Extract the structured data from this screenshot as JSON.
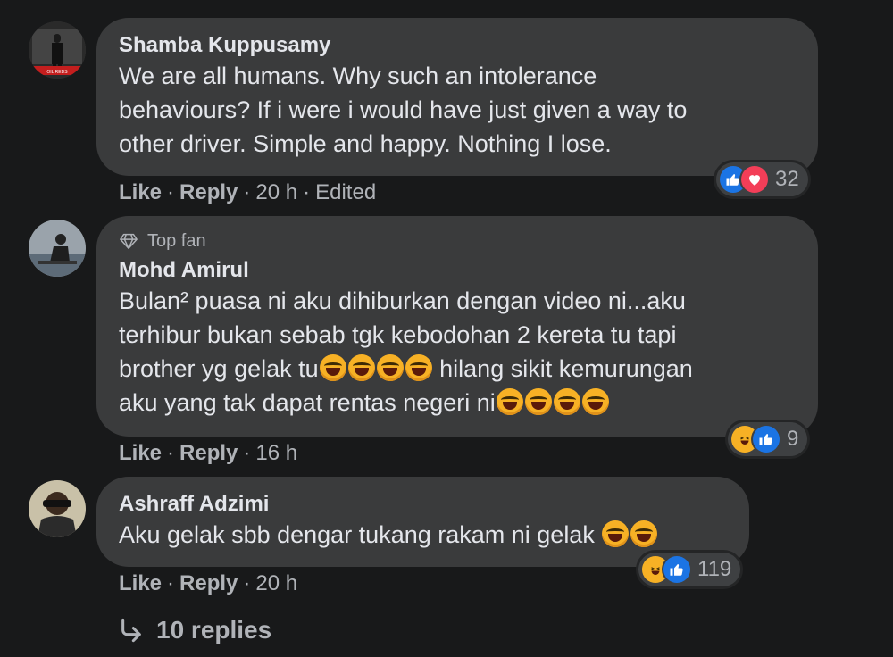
{
  "comments": [
    {
      "author": "Shamba Kuppusamy",
      "lines": [
        "We are all humans. Why such an intolerance",
        "behaviours? If i were i would have just given a way to",
        "other driver. Simple and happy. Nothing I lose."
      ],
      "like_label": "Like",
      "reply_label": "Reply",
      "time": "20 h",
      "edited": "Edited",
      "reaction_count": "32",
      "reaction_icons": [
        "like-icon",
        "love-icon"
      ],
      "avatar_caption": "OIL REDS"
    },
    {
      "badge": "Top fan",
      "author": "Mohd Amirul",
      "lines": [
        "Bulan² puasa ni aku dihiburkan dengan video ni...aku",
        "terhibur bukan sebab tgk kebodohan 2 kereta tu tapi",
        "brother yg gelak tu",
        " hilang sikit kemurungan",
        "aku yang tak dapat rentas negeri ni"
      ],
      "like_label": "Like",
      "reply_label": "Reply",
      "time": "16 h",
      "reaction_count": "9",
      "reaction_icons": [
        "haha-icon",
        "like-icon"
      ]
    },
    {
      "author": "Ashraff Adzimi",
      "lines": [
        "Aku gelak sbb dengar tukang rakam ni gelak "
      ],
      "like_label": "Like",
      "reply_label": "Reply",
      "time": "20 h",
      "reaction_count": "119",
      "reaction_icons": [
        "haha-icon",
        "like-icon"
      ]
    }
  ],
  "replies_label": "10 replies",
  "colors": {
    "background": "#18191a",
    "bubble": "#3a3b3c",
    "text": "#e4e6eb",
    "secondary": "#b0b3b8",
    "like": "#1b74e4",
    "love": "#f33e58",
    "haha": "#f7b125"
  }
}
